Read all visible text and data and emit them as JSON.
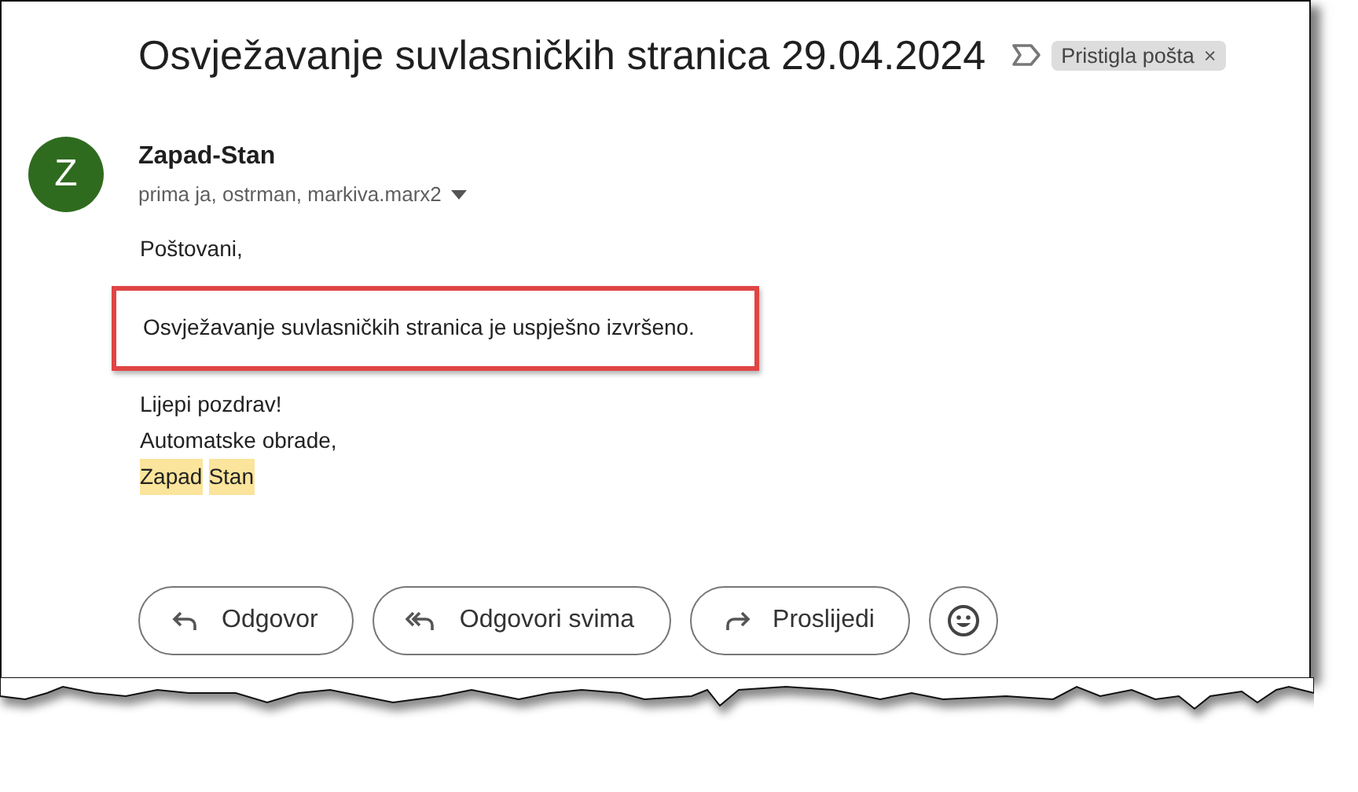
{
  "subject": "Osvježavanje suvlasničkih stranica 29.04.2024",
  "label": {
    "text": "Pristigla pošta",
    "close": "×"
  },
  "sender": {
    "avatar": "Z",
    "name": "Zapad-Stan",
    "recipients": "prima ja, ostrman, markiva.marx2"
  },
  "body": [
    {
      "text": "Poštovani,",
      "boxed": false
    },
    {
      "text": "Osvježavanje suvlasničkih stranica je uspješno izvršeno.",
      "boxed": true
    }
  ],
  "closing": [
    "Lijepi pozdrav!",
    "Automatske obrade,"
  ],
  "signature": [
    {
      "text": "Zapad",
      "highlighted": true
    },
    {
      "text": "Stan",
      "highlighted": true
    }
  ],
  "actions": [
    {
      "kind": "reply",
      "label": "Odgovor"
    },
    {
      "kind": "reply_all",
      "label": "Odgovori svima"
    },
    {
      "kind": "forward",
      "label": "Proslijedi"
    },
    {
      "kind": "emoji"
    }
  ]
}
